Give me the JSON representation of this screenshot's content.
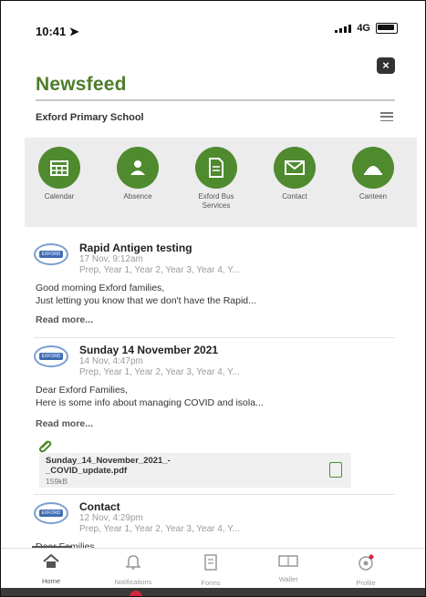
{
  "status": {
    "time": "10:41",
    "network": "4G"
  },
  "header": {
    "title": "Newsfeed",
    "school": "Exford Primary School"
  },
  "shortcuts": [
    {
      "label": "Calendar",
      "icon": "calendar-icon"
    },
    {
      "label": "Absence",
      "icon": "absence-icon"
    },
    {
      "label": "Exford Bus Services",
      "icon": "document-icon"
    },
    {
      "label": "Contact",
      "icon": "envelope-icon"
    },
    {
      "label": "Canteen",
      "icon": "canteen-icon"
    }
  ],
  "posts": [
    {
      "title": "Rapid Antigen testing",
      "date": "17 Nov, 9:12am",
      "groups": "Prep, Year 1, Year 2, Year 3, Year 4, Y...",
      "body1": "Good morning Exford families,",
      "body2": "Just letting you know that we don't have the Rapid...",
      "more": "Read more..."
    },
    {
      "title": "Sunday 14 November 2021",
      "date": "14 Nov, 4:47pm",
      "groups": "Prep, Year 1, Year 2, Year 3, Year 4, Y...",
      "body1": "Dear Exford Families,",
      "body2": "Here is some info about managing COVID and isola...",
      "more": "Read more..."
    },
    {
      "title": "Contact",
      "date": "12 Nov, 4:29pm",
      "groups": "Prep, Year 1, Year 2, Year 3, Year 4, Y...",
      "body1": "Dear Families,"
    }
  ],
  "attachment": {
    "name_line1": "Sunday_14_November_2021_-",
    "name_line2": "_COVID_update.pdf",
    "size": "159kB"
  },
  "tabs": [
    {
      "label": "Home",
      "icon": "home-icon"
    },
    {
      "label": "Notifications",
      "icon": "bell-icon"
    },
    {
      "label": "Forms",
      "icon": "forms-icon"
    },
    {
      "label": "Wallet",
      "icon": "wallet-icon"
    },
    {
      "label": "Profile",
      "icon": "profile-icon"
    }
  ]
}
